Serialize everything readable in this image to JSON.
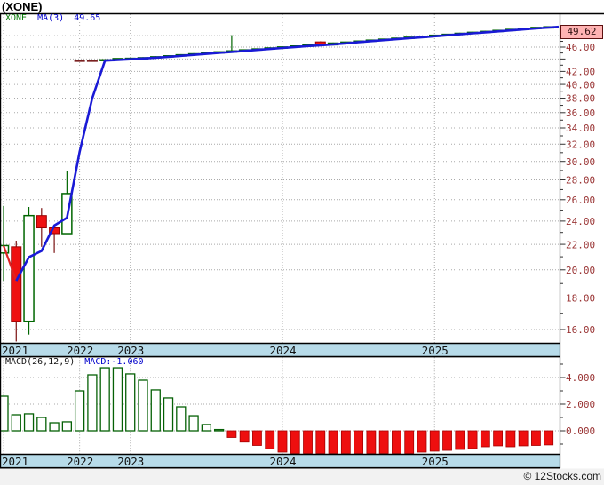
{
  "title": "(XONE)",
  "legend": {
    "symbol": "XONE",
    "ma_label": "MA(3)",
    "ma_value": "49.65"
  },
  "macd_legend": {
    "params": "MACD(26,12,9)",
    "value_label": "MACD:-1.060"
  },
  "price_tag": {
    "label": "49.62"
  },
  "watermark": "© 12Stocks.com",
  "colors": {
    "band": "#b7dbe9",
    "grid": "#a9a9a9",
    "axis_label": "#993333",
    "up": "#006600",
    "down": "#ee1111",
    "down_border": "#990000",
    "flat_red": "#7a2020",
    "ma_line": "#1a1ad6",
    "ma_start": "#dd2222",
    "macd_pos_border": "#056005",
    "macd_neg": "#ee0f0f",
    "macd_neg_border": "#a50000",
    "tag_bg": "#ffb3b3",
    "year_label": "#111111",
    "bottom_strip": "#f2f2f2"
  },
  "chart_data": [
    {
      "type": "candlestick",
      "title": "(XONE)",
      "symbol": "XONE",
      "overlay": "MA(3)",
      "overlay_value": 49.65,
      "last_price": 49.62,
      "y_scale": "log",
      "ylim": [
        15.0,
        50.5
      ],
      "y_ticks_labeled": [
        16,
        18,
        20,
        22,
        24,
        26,
        28,
        30,
        32,
        34,
        36,
        38,
        40,
        42,
        46
      ],
      "y_gridlines": [
        16,
        18,
        20,
        22,
        24,
        26,
        28,
        30,
        32,
        34,
        36,
        38,
        40,
        42,
        44,
        46,
        48
      ],
      "years": [
        {
          "label": "2021",
          "bar": 0
        },
        {
          "label": "2022",
          "bar": 6
        },
        {
          "label": "2023",
          "bar": 10
        },
        {
          "label": "2024",
          "bar": 22
        },
        {
          "label": "2025",
          "bar": 34
        }
      ],
      "candles": [
        {
          "o": 21.3,
          "h": 25.4,
          "l": 19.2,
          "c": 21.9
        },
        {
          "o": 21.8,
          "h": 22.3,
          "l": 15.3,
          "c": 16.5
        },
        {
          "o": 16.5,
          "h": 25.3,
          "l": 15.7,
          "c": 24.5
        },
        {
          "o": 24.5,
          "h": 25.2,
          "l": 21.8,
          "c": 23.4
        },
        {
          "o": 23.4,
          "h": 23.4,
          "l": 21.3,
          "c": 22.9
        },
        {
          "o": 22.9,
          "h": 28.9,
          "l": 22.9,
          "c": 26.6
        },
        {
          "o": 43.7,
          "h": 43.7,
          "l": 43.7,
          "c": 43.7,
          "f": "r"
        },
        {
          "o": 43.7,
          "h": 43.7,
          "l": 43.7,
          "c": 43.7,
          "f": "r"
        },
        {
          "o": 43.8,
          "h": 43.8,
          "l": 43.8,
          "c": 43.8,
          "f": "g"
        },
        {
          "o": 44.0,
          "h": 44.0,
          "l": 44.0,
          "c": 44.0,
          "f": "g"
        },
        {
          "o": 44.05,
          "h": 44.05,
          "l": 44.05,
          "c": 44.05,
          "f": "g"
        },
        {
          "o": 44.05,
          "h": 44.31,
          "l": 43.95,
          "c": 44.21
        },
        {
          "o": 44.21,
          "h": 44.47,
          "l": 44.11,
          "c": 44.37
        },
        {
          "o": 44.37,
          "h": 44.63,
          "l": 44.27,
          "c": 44.53
        },
        {
          "o": 44.53,
          "h": 44.8,
          "l": 44.43,
          "c": 44.7
        },
        {
          "o": 44.7,
          "h": 44.96,
          "l": 44.6,
          "c": 44.86
        },
        {
          "o": 44.86,
          "h": 45.12,
          "l": 44.76,
          "c": 45.02
        },
        {
          "o": 45.02,
          "h": 45.29,
          "l": 44.92,
          "c": 45.19
        },
        {
          "o": 45.19,
          "h": 48.1,
          "l": 45.09,
          "c": 45.35
        },
        {
          "o": 45.35,
          "h": 45.62,
          "l": 45.25,
          "c": 45.52
        },
        {
          "o": 45.52,
          "h": 45.78,
          "l": 45.42,
          "c": 45.68
        },
        {
          "o": 45.68,
          "h": 45.95,
          "l": 45.58,
          "c": 45.85
        },
        {
          "o": 45.85,
          "h": 46.12,
          "l": 45.75,
          "c": 46.02
        },
        {
          "o": 46.02,
          "h": 46.29,
          "l": 45.92,
          "c": 46.19
        },
        {
          "o": 46.19,
          "h": 46.45,
          "l": 46.09,
          "c": 46.35
        },
        {
          "o": 46.9,
          "h": 47.0,
          "l": 46.3,
          "c": 46.4
        },
        {
          "o": 46.4,
          "h": 46.79,
          "l": 46.3,
          "c": 46.69
        },
        {
          "o": 46.69,
          "h": 46.96,
          "l": 46.59,
          "c": 46.86
        },
        {
          "o": 46.86,
          "h": 47.14,
          "l": 46.76,
          "c": 47.04
        },
        {
          "o": 47.04,
          "h": 47.31,
          "l": 46.94,
          "c": 47.21
        },
        {
          "o": 47.21,
          "h": 47.48,
          "l": 47.11,
          "c": 47.38
        },
        {
          "o": 47.38,
          "h": 47.65,
          "l": 47.28,
          "c": 47.55
        },
        {
          "o": 47.55,
          "h": 47.83,
          "l": 47.45,
          "c": 47.73
        },
        {
          "o": 47.73,
          "h": 48.0,
          "l": 47.63,
          "c": 47.9
        },
        {
          "o": 47.9,
          "h": 48.18,
          "l": 47.8,
          "c": 48.08
        },
        {
          "o": 48.08,
          "h": 48.35,
          "l": 47.98,
          "c": 48.25
        },
        {
          "o": 48.25,
          "h": 48.53,
          "l": 48.15,
          "c": 48.43
        },
        {
          "o": 48.43,
          "h": 48.71,
          "l": 48.33,
          "c": 48.61
        },
        {
          "o": 48.61,
          "h": 48.88,
          "l": 48.51,
          "c": 48.78
        },
        {
          "o": 48.78,
          "h": 49.06,
          "l": 48.68,
          "c": 48.96
        },
        {
          "o": 48.96,
          "h": 49.24,
          "l": 48.86,
          "c": 49.14
        },
        {
          "o": 49.14,
          "h": 49.42,
          "l": 49.04,
          "c": 49.32
        },
        {
          "o": 49.32,
          "h": 49.6,
          "l": 49.22,
          "c": 49.5
        },
        {
          "o": 49.5,
          "h": 49.72,
          "l": 49.4,
          "c": 49.62
        }
      ]
    },
    {
      "type": "bar",
      "name": "MACD histogram",
      "params": "MACD(26,12,9)",
      "last_value": -1.06,
      "y_ticks_labeled": [
        4,
        2,
        0
      ],
      "positive_style": "hollow-green",
      "negative_style": "solid-red",
      "values": [
        2.6,
        1.2,
        1.27,
        1.0,
        0.6,
        0.67,
        3.0,
        4.2,
        4.73,
        4.73,
        4.27,
        3.8,
        3.07,
        2.47,
        1.8,
        1.13,
        0.47,
        0.05,
        -0.5,
        -0.85,
        -1.1,
        -1.35,
        -1.6,
        -1.75,
        -1.85,
        -1.95,
        -1.85,
        -1.95,
        -1.85,
        -1.9,
        -1.85,
        -1.8,
        -1.73,
        -1.6,
        -1.53,
        -1.47,
        -1.4,
        -1.33,
        -1.2,
        -1.13,
        -1.2,
        -1.13,
        -1.1,
        -1.06
      ]
    }
  ]
}
